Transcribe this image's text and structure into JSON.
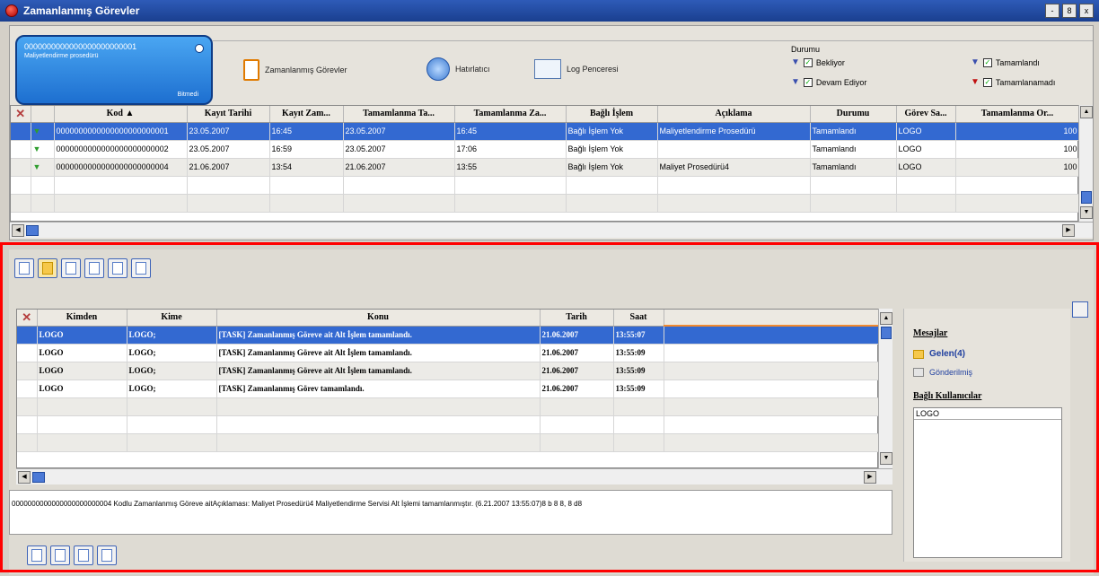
{
  "window": {
    "title": "Zamanlanmış Görevler",
    "buttons": [
      "-",
      "8",
      "x"
    ]
  },
  "active_task": {
    "code": "0000000000000000000000001",
    "desc": "Maliyetlendirme prosedürü",
    "small": "Bitmedi"
  },
  "toolbar": {
    "scheduled_tasks": "Zamanlanmış Görevler",
    "reminder": "Hatırlatıcı",
    "log_window": "Log Penceresi"
  },
  "status_filter": {
    "label": "Durumu",
    "waiting": "Bekliyor",
    "in_progress": "Devam Ediyor",
    "completed": "Tamamlandı",
    "not_completed": "Tamamlanamadı"
  },
  "tasks": {
    "columns": [
      "Kod",
      "Kayıt Tarihi",
      "Kayıt Zam...",
      "Tamamlanma Ta...",
      "Tamamlanma Za...",
      "Bağlı İşlem",
      "Açıklama",
      "Durumu",
      "Görev Sa...",
      "Tamamlanma Or..."
    ],
    "rows": [
      [
        "0000000000000000000000001",
        "23.05.2007",
        "16:45",
        "23.05.2007",
        "16:45",
        "Bağlı İşlem Yok",
        "Maliyetlendirme Prosedürü",
        "Tamamlandı",
        "LOGO",
        "100"
      ],
      [
        "0000000000000000000000002",
        "23.05.2007",
        "16:59",
        "23.05.2007",
        "17:06",
        "Bağlı İşlem Yok",
        "",
        "Tamamlandı",
        "LOGO",
        "100"
      ],
      [
        "0000000000000000000000004",
        "21.06.2007",
        "13:54",
        "21.06.2007",
        "13:55",
        "Bağlı İşlem Yok",
        "Maliyet Prosedürü4",
        "Tamamlandı",
        "LOGO",
        "100"
      ]
    ]
  },
  "mail": {
    "columns": [
      "Kimden",
      "Kime",
      "Konu",
      "Tarih",
      "Saat"
    ],
    "rows": [
      [
        "LOGO",
        "LOGO;",
        "[TASK] Zamanlanmış Göreve ait Alt İşlem tamamlandı.",
        "21.06.2007",
        "13:55:07"
      ],
      [
        "LOGO",
        "LOGO;",
        "[TASK] Zamanlanmış Göreve ait Alt İşlem tamamlandı.",
        "21.06.2007",
        "13:55:09"
      ],
      [
        "LOGO",
        "LOGO;",
        "[TASK] Zamanlanmış Göreve ait Alt İşlem tamamlandı.",
        "21.06.2007",
        "13:55:09"
      ],
      [
        "LOGO",
        "LOGO;",
        "[TASK] Zamanlanmış Görev tamamlandı.",
        "21.06.2007",
        "13:55:09"
      ]
    ]
  },
  "preview_text": "0000000000000000000000004 Kodlu Zamanlanmış Göreve aitAçıklaması: Maliyet Prosedürü4 Maliyetlendirme Servisi Alt İşlemi tamamlanmıştır. (6.21.2007 13:55:07)8 b 8 8, 8 d8",
  "messages_panel": {
    "title": "Mesajlar",
    "inbox": "Gelen(4)",
    "sent": "Gönderilmiş",
    "users_title": "Bağlı Kullanıcılar",
    "users": [
      "LOGO"
    ]
  }
}
